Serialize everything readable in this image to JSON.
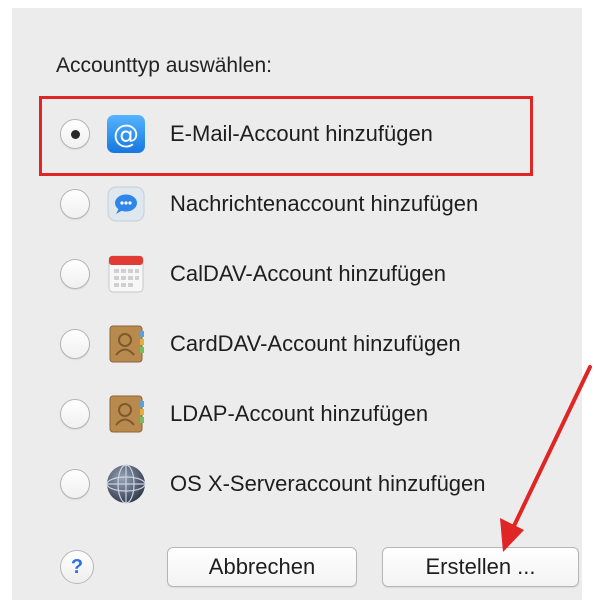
{
  "dialog": {
    "heading": "Accounttyp auswählen:"
  },
  "options": [
    {
      "label": "E-Mail-Account hinzufügen",
      "selected": true,
      "icon": "at-sign-icon"
    },
    {
      "label": "Nachrichtenaccount hinzufügen",
      "selected": false,
      "icon": "messages-bubble-icon"
    },
    {
      "label": "CalDAV-Account hinzufügen",
      "selected": false,
      "icon": "calendar-icon"
    },
    {
      "label": "CardDAV-Account hinzufügen",
      "selected": false,
      "icon": "contacts-book-icon"
    },
    {
      "label": "LDAP-Account hinzufügen",
      "selected": false,
      "icon": "contacts-book-icon"
    },
    {
      "label": "OS X-Serveraccount hinzufügen",
      "selected": false,
      "icon": "globe-server-icon"
    }
  ],
  "footer": {
    "help": "?",
    "cancel_label": "Abbrechen",
    "create_label": "Erstellen ..."
  },
  "colors": {
    "highlight": "#e02525",
    "panel": "#ececec",
    "accent": "#2d6fe0"
  }
}
